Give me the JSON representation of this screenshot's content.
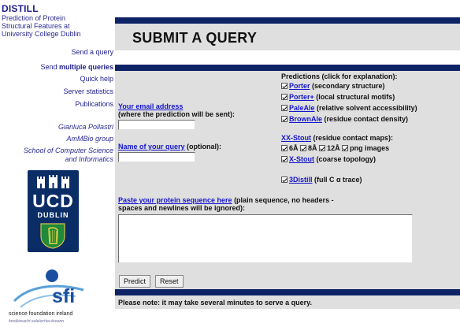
{
  "sidebar": {
    "brand": "DISTILL",
    "subtitle": "Prediction of Protein Structural Features at University College Dublin",
    "nav": [
      {
        "label": "Send a query"
      },
      {
        "prefix": "Send ",
        "bold": "multiple queries"
      },
      {
        "label": "Quick help"
      },
      {
        "label": "Server statistics"
      },
      {
        "label": "Publications"
      }
    ],
    "authors": [
      "Gianluca Pollastri",
      "AmMBio group",
      "School of Computer Science",
      "and Informatics"
    ],
    "ucd_logo": {
      "text": "UCD",
      "sub": "DUBLIN"
    },
    "sfi_logo": {
      "text": "sfi",
      "sub": "science foundation ireland",
      "sub2": "fondúireacht eolaíochta éireann"
    }
  },
  "main": {
    "title": "SUBMIT A QUERY",
    "email": {
      "label": "Your email address",
      "hint": "(where the prediction will be sent):",
      "value": ""
    },
    "query_name": {
      "label": "Name of your query",
      "hint": " (optional):",
      "value": ""
    },
    "predictions_header": "Predictions (click for explanation):",
    "predictions": [
      {
        "name": "Porter",
        "desc": " (secondary structure)"
      },
      {
        "name": "Porter+",
        "desc": " (local structural motifs)"
      },
      {
        "name": "PaleAle",
        "desc": " (relative solvent accessibility)"
      },
      {
        "name": "BrownAle",
        "desc": " (residue contact density)"
      }
    ],
    "xxstout": {
      "name": "XX-Stout",
      "desc": " (residue contact maps):"
    },
    "maps": [
      "6Å",
      "8Å",
      "12Å",
      "png images"
    ],
    "xstout": {
      "name": "X-Stout",
      "desc": " (coarse topology)"
    },
    "threedistill": {
      "name": "3Distill",
      "desc": " (full C α trace)"
    },
    "sequence": {
      "label": "Paste your protein sequence here",
      "desc": " (plain sequence, no headers - spaces and newlines will be ignored):",
      "value": ""
    },
    "predict_label": "Predict",
    "reset_label": "Reset",
    "note": "Please note: it may take several minutes to serve a query."
  }
}
